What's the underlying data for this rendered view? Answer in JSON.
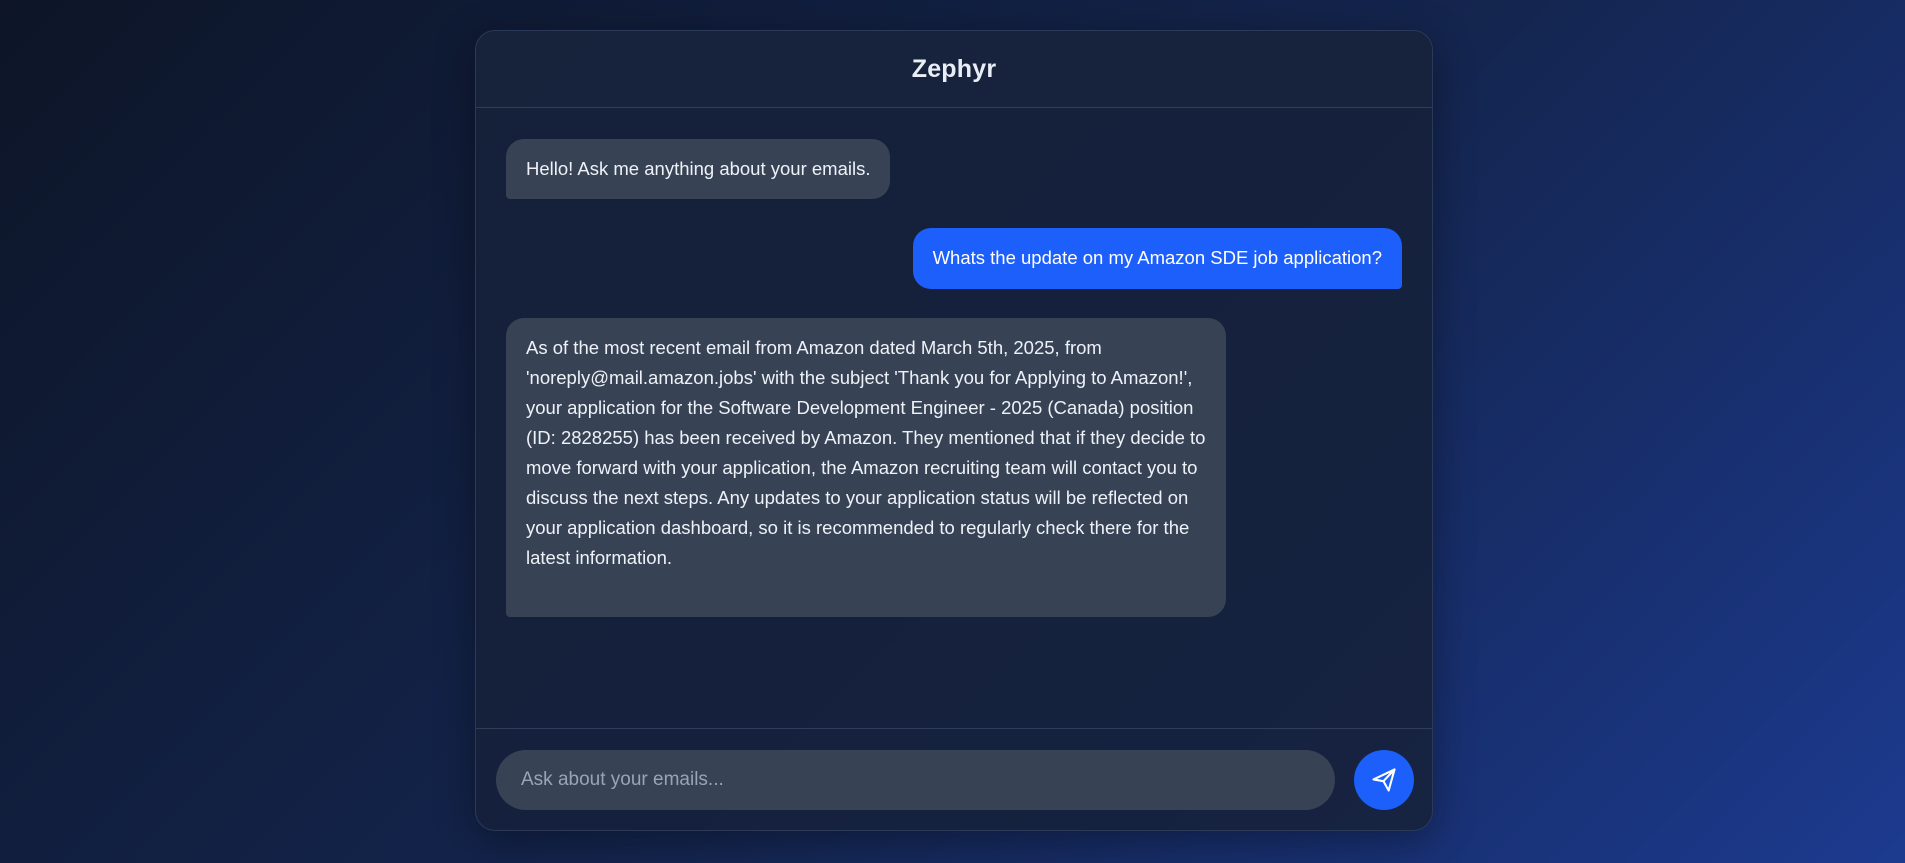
{
  "header": {
    "title": "Zephyr"
  },
  "messages": [
    {
      "role": "bot",
      "text": "Hello! Ask me anything about your emails."
    },
    {
      "role": "user",
      "text": "Whats the update on my Amazon SDE job application?"
    },
    {
      "role": "bot",
      "text": "As of the most recent email from Amazon dated March 5th, 2025, from 'noreply@mail.amazon.jobs' with the subject 'Thank you for Applying to Amazon!', your application for the Software Development Engineer - 2025 (Canada) position (ID: 2828255) has been received by Amazon. They mentioned that if they decide to move forward with your application, the Amazon recruiting team will contact you to discuss the next steps. Any updates to your application status will be reflected on your application dashboard, so it is recommended to regularly check there for the latest information."
    }
  ],
  "input": {
    "placeholder": "Ask about your emails...",
    "value": ""
  },
  "send_button": {
    "icon": "send-icon"
  },
  "colors": {
    "accent": "#1c5ffb",
    "bot_bubble": "#374355",
    "panel": "#16213a"
  }
}
